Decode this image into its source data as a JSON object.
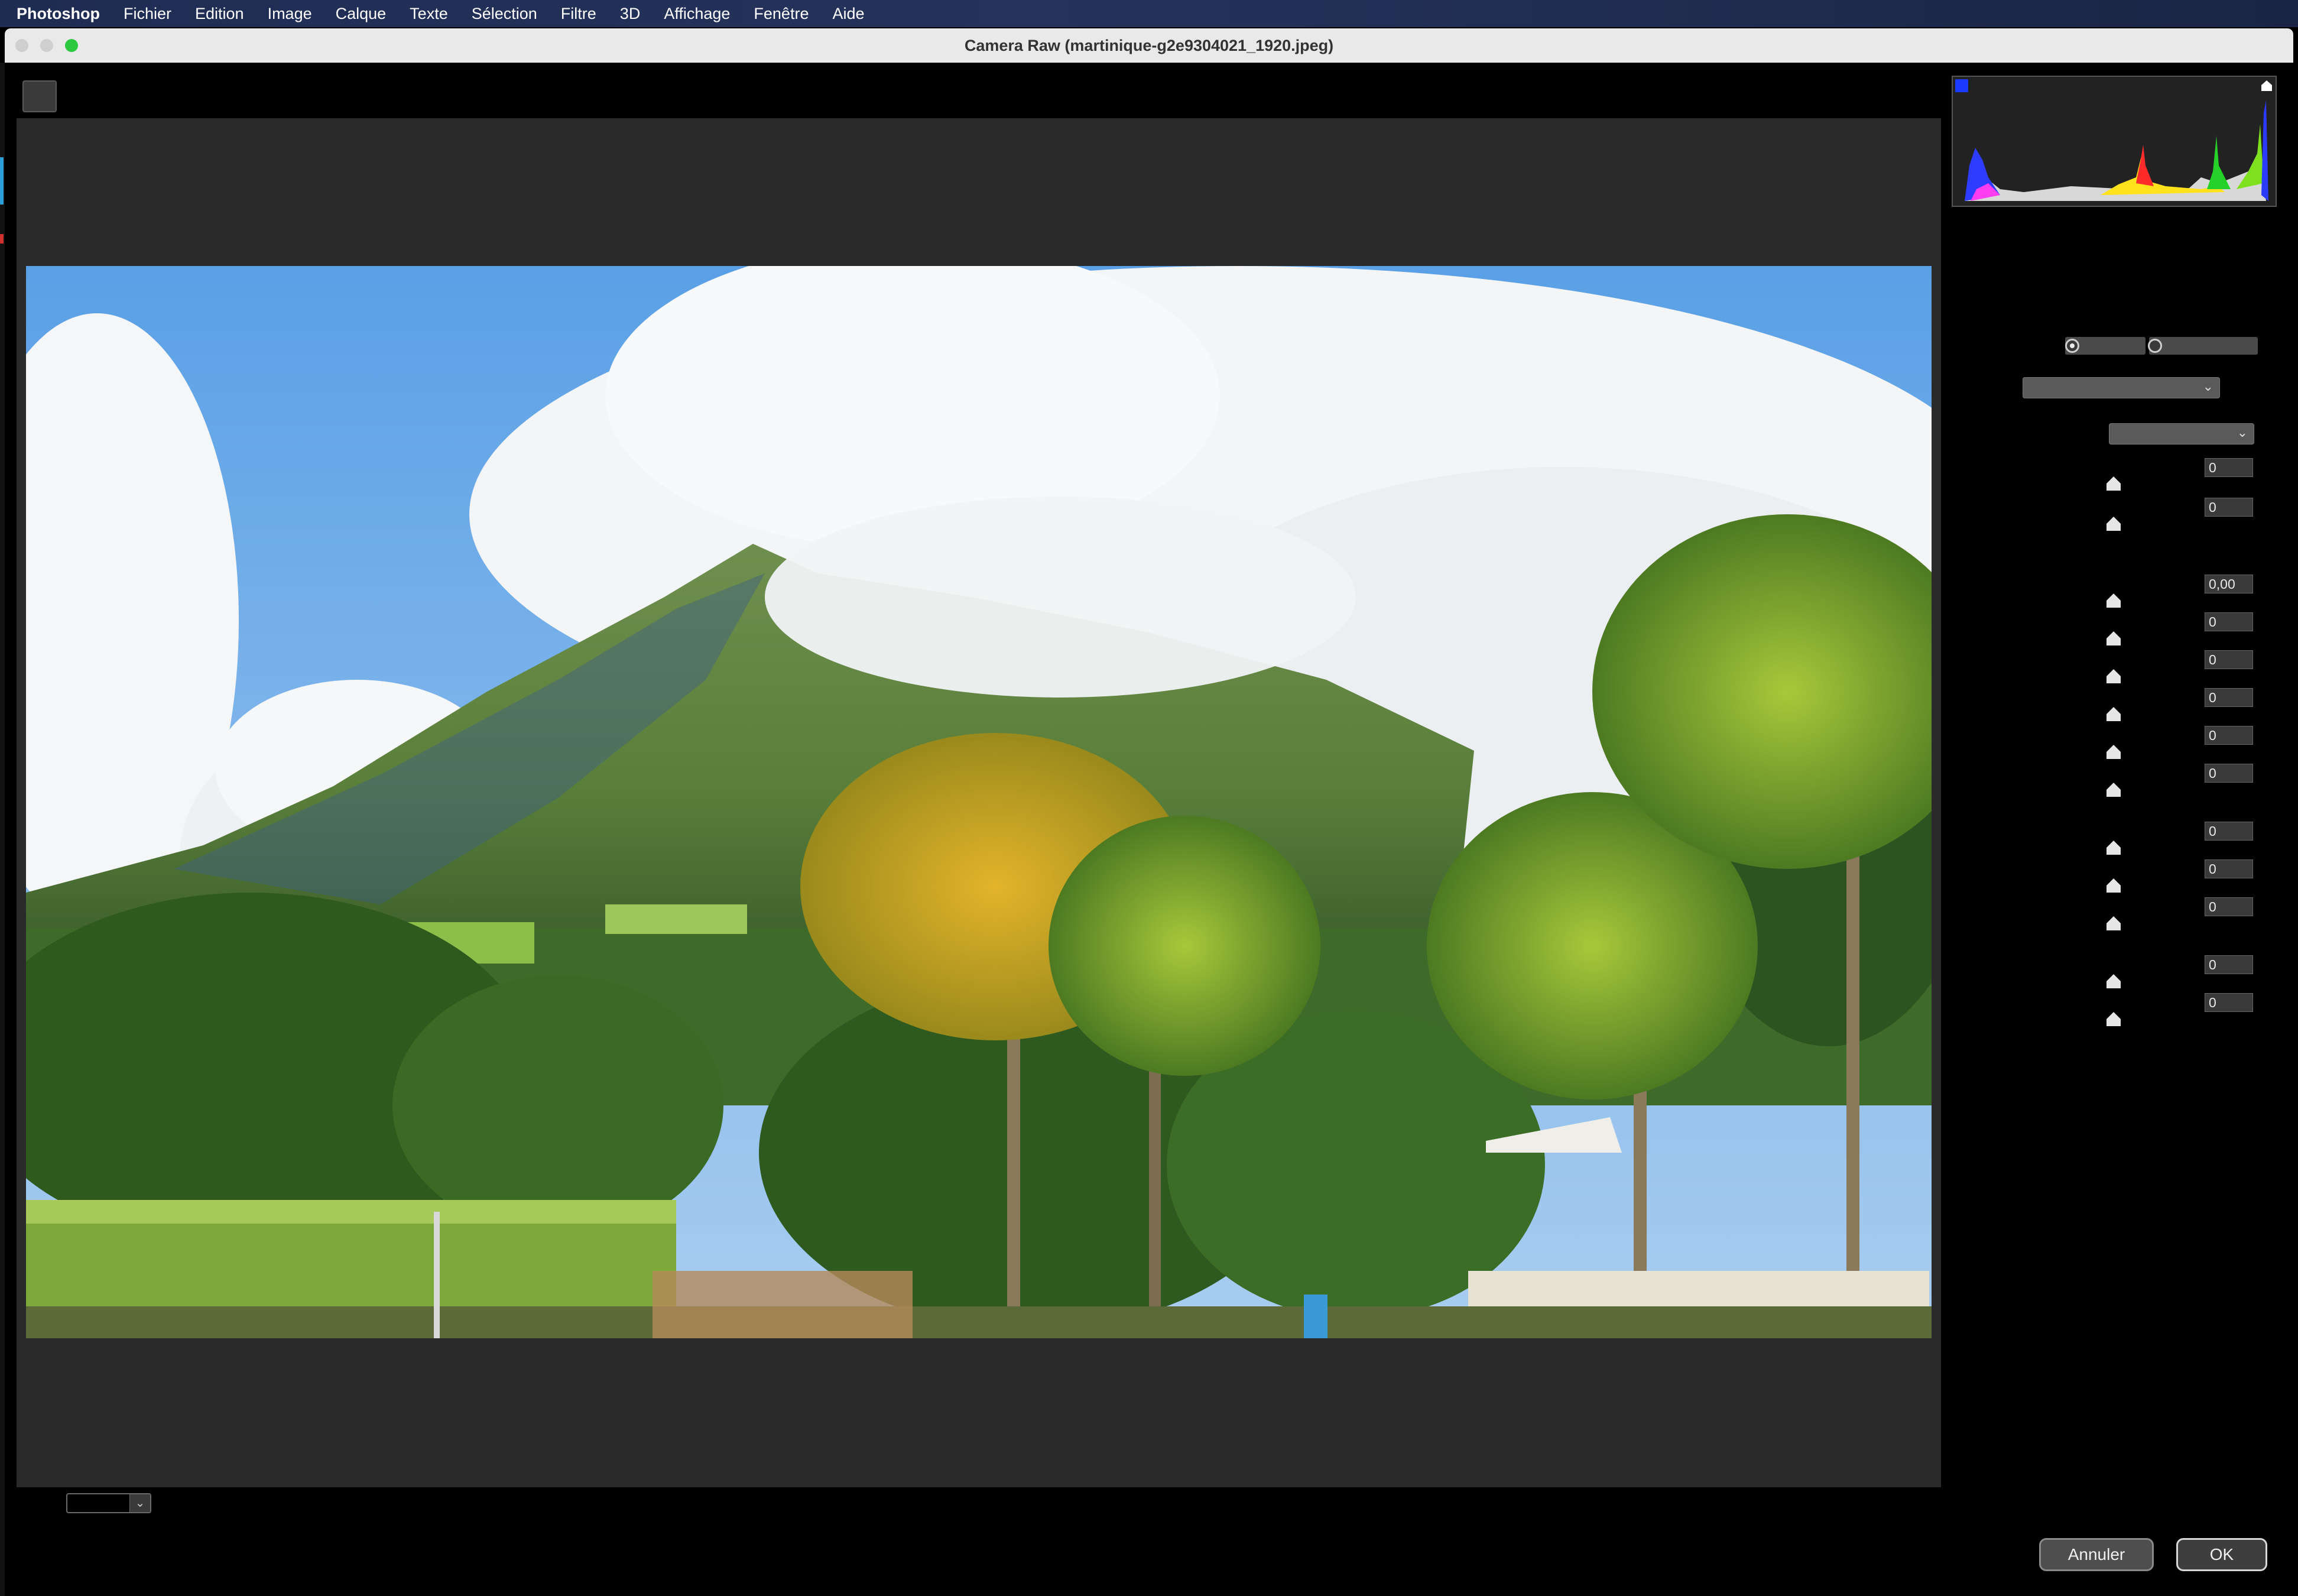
{
  "menubar": {
    "app": "Photoshop",
    "items": [
      "Fichier",
      "Edition",
      "Image",
      "Calque",
      "Texte",
      "Sélection",
      "Filtre",
      "3D",
      "Affichage",
      "Fenêtre",
      "Aide"
    ]
  },
  "window": {
    "title": "Camera Raw (martinique-g2e9304021_1920.jpeg)",
    "traffic_lights": {
      "close": "#d0d0d0",
      "minimize": "#d0d0d0",
      "zoom": "#2bc840"
    }
  },
  "panel": {
    "histogram": {
      "shadow_clip_color": "#1a3bff",
      "highlight_clip_color": "#ffffff"
    },
    "fields": [
      "0",
      "0",
      "0,00",
      "0",
      "0",
      "0",
      "0",
      "0",
      "0",
      "0",
      "0",
      "0",
      "0",
      "0"
    ]
  },
  "footer": {
    "cancel_label": "Annuler",
    "ok_label": "OK"
  },
  "icons": [
    "close-dot-icon",
    "minimize-dot-icon",
    "zoom-dot-icon",
    "chevron-down-icon",
    "slider-thumb-icon"
  ]
}
